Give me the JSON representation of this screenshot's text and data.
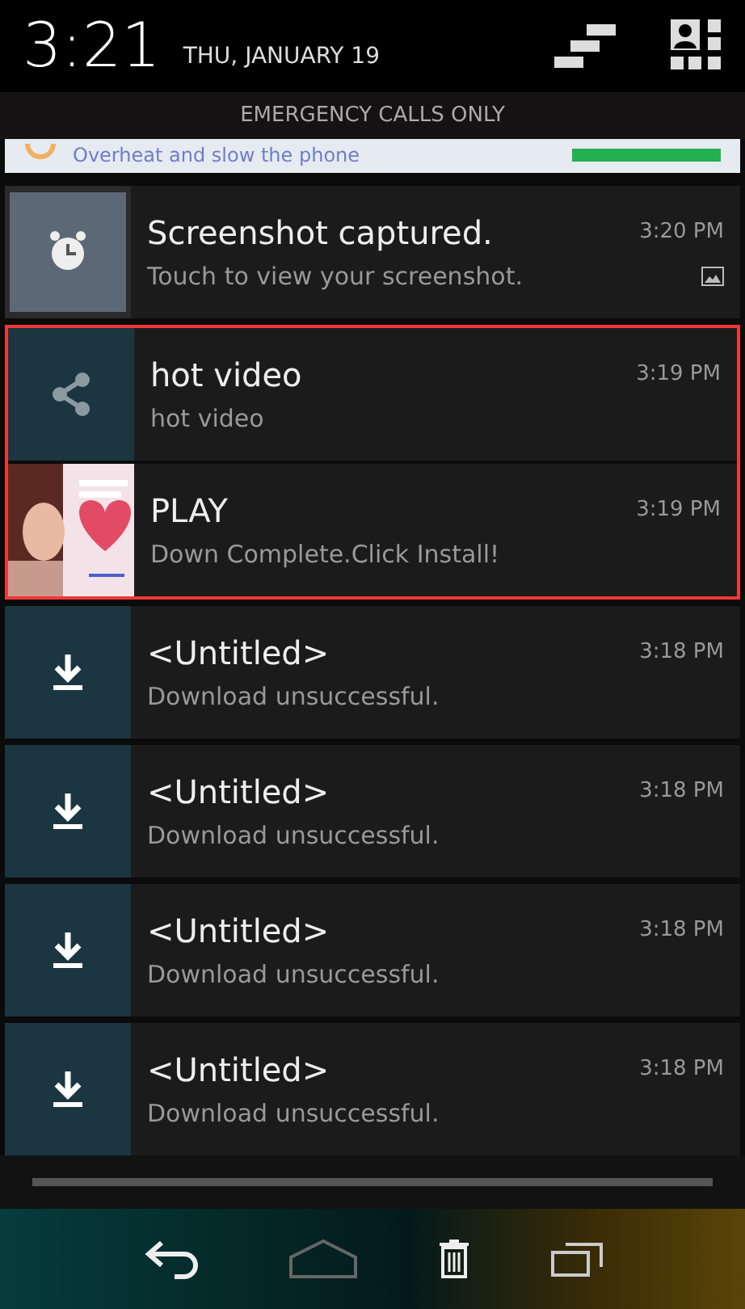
{
  "status_bar": {
    "time": "3:21",
    "date": "THU, JANUARY 19"
  },
  "carrier_notice": "EMERGENCY CALLS ONLY",
  "banner": {
    "text": "Overheat and slow the phone"
  },
  "notifications": [
    {
      "kind": "screenshot",
      "title": "Screenshot captured.",
      "text": "Touch to view your screenshot.",
      "time": "3:20 PM",
      "highlighted": false
    },
    {
      "kind": "share",
      "title": "hot video",
      "text": "hot video",
      "time": "3:19 PM",
      "highlighted": true
    },
    {
      "kind": "ad",
      "title": "PLAY",
      "text": "Down Complete.Click Install!",
      "time": "3:19 PM",
      "highlighted": true
    },
    {
      "kind": "download",
      "title": "<Untitled>",
      "text": "Download unsuccessful.",
      "time": "3:18 PM",
      "highlighted": false
    },
    {
      "kind": "download",
      "title": "<Untitled>",
      "text": "Download unsuccessful.",
      "time": "3:18 PM",
      "highlighted": false
    },
    {
      "kind": "download",
      "title": "<Untitled>",
      "text": "Download unsuccessful.",
      "time": "3:18 PM",
      "highlighted": false
    },
    {
      "kind": "download",
      "title": "<Untitled>",
      "text": "Download unsuccessful.",
      "time": "3:18 PM",
      "highlighted": false
    }
  ]
}
